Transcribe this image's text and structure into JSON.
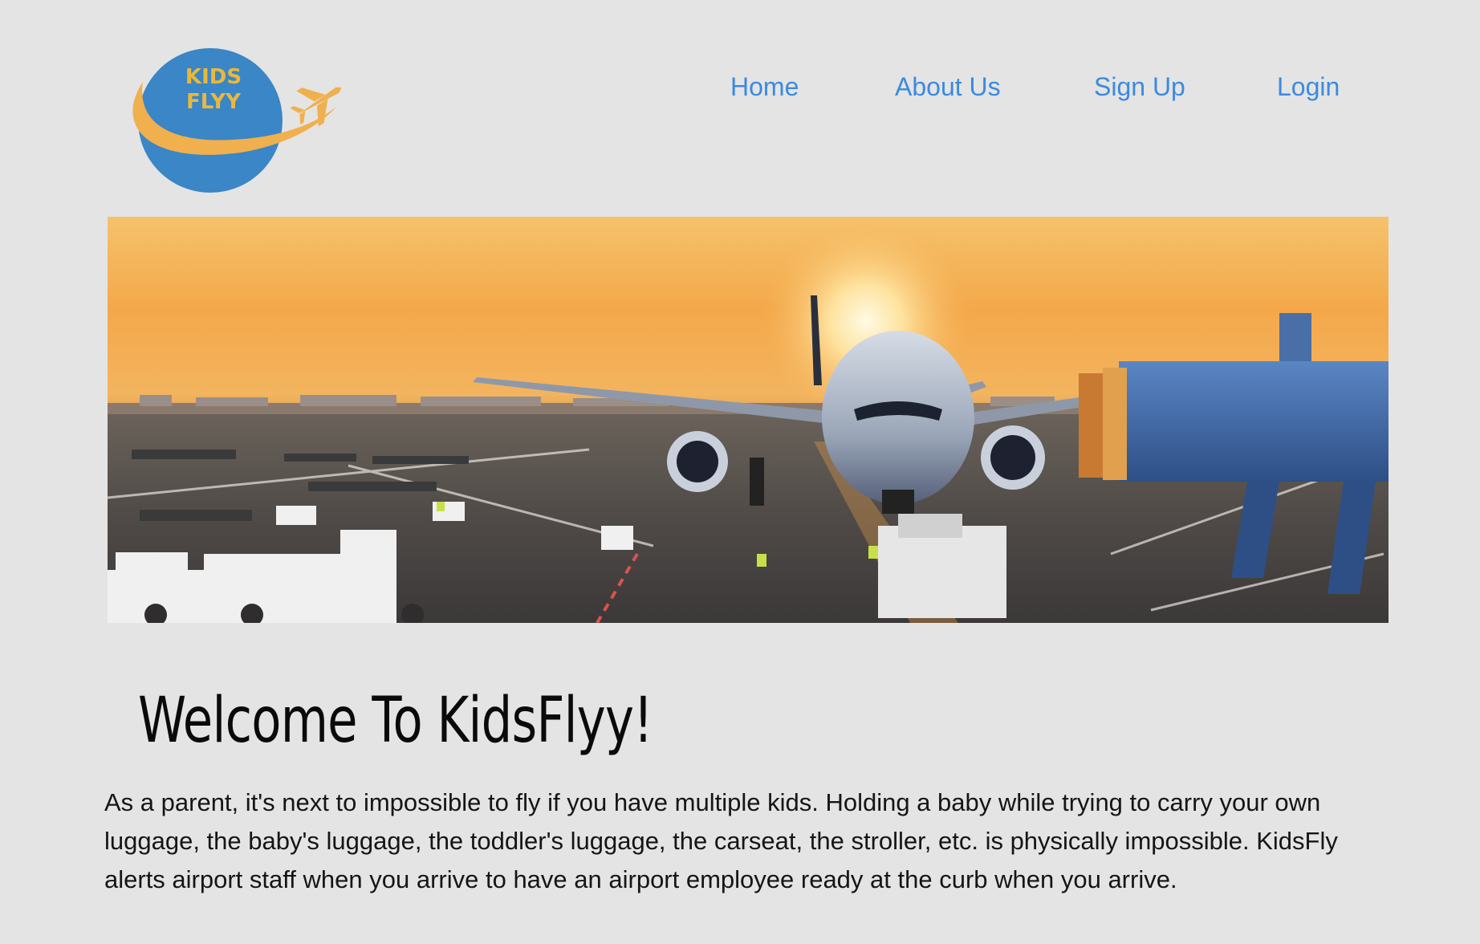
{
  "logo": {
    "line1": "KIDS",
    "line2": "FLYY",
    "colors": {
      "globe": "#3a86c6",
      "swoosh": "#f0b04e",
      "text": "#e9b83c"
    }
  },
  "nav": {
    "items": [
      "Home",
      "About Us",
      "Sign Up",
      "Login"
    ],
    "link_color": "#3b8ae0"
  },
  "hero": {
    "description": "airplane-at-gate-sunset-photo"
  },
  "main": {
    "title": "Welcome To KidsFlyy!",
    "body": "As a parent, it's next to impossible to fly if you have multiple kids. Holding a baby while trying to carry your own luggage, the baby's luggage, the toddler's luggage, the carseat, the stroller, etc. is physically impossible. KidsFly alerts airport staff when you arrive to have an airport employee ready at the curb when you arrive."
  },
  "colors": {
    "background": "#e4e4e4",
    "text": "#151515"
  }
}
